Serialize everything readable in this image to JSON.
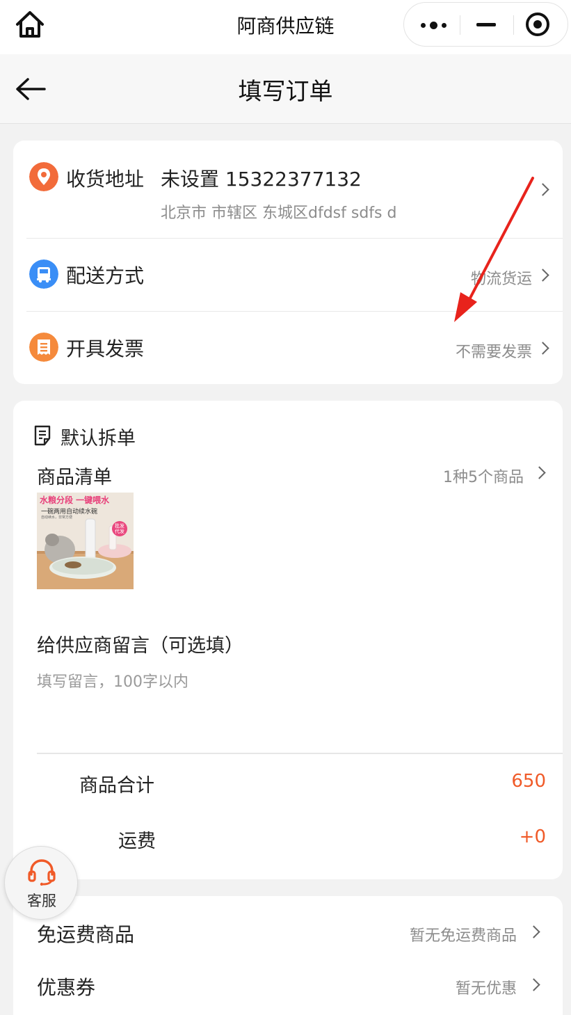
{
  "topbar": {
    "app_title": "阿商供应链",
    "home_icon": "home-icon",
    "menu_icon": "more-dots-icon",
    "minimize_icon": "minimize-icon",
    "close_icon": "target-close-icon"
  },
  "navbar": {
    "title": "填写订单",
    "back_icon": "back-arrow-icon"
  },
  "address": {
    "label": "收货地址",
    "main": "未设置 15322377132",
    "detail": "北京市 市辖区 东城区dfdsf sdfs d",
    "icon": "location-pin-icon",
    "icon_color": "#f26b3a"
  },
  "delivery": {
    "label": "配送方式",
    "value": "物流货运",
    "icon": "truck-icon",
    "icon_color": "#3a8ef6"
  },
  "invoice": {
    "label": "开具发票",
    "value": "不需要发票",
    "icon": "receipt-icon",
    "icon_color": "#f58a3c"
  },
  "order": {
    "split_title": "默认拆单",
    "goods_title": "商品清单",
    "goods_count": "1种5个商品",
    "product_image": {
      "headline": "水粮分段 一键喂水",
      "subline": "一碗两用自动续水碗",
      "tiny": "自动续水，非常方便",
      "badge": "批发代发"
    },
    "message_title": "给供应商留言（可选填）",
    "message_placeholder": "填写留言，100字以内",
    "subtotal_label": "商品合计",
    "subtotal_value": "650",
    "shipping_label": "运费",
    "shipping_value": "+0"
  },
  "extras": {
    "free_shipping_label": "免运费商品",
    "free_shipping_value": "暂无免运费商品",
    "coupon_label": "优惠券",
    "coupon_value": "暂无优惠"
  },
  "customer_service": {
    "label": "客服",
    "icon": "headset-icon",
    "color": "#f05a28"
  },
  "colors": {
    "accent": "#f05a28",
    "annotation": "#e8231c"
  }
}
